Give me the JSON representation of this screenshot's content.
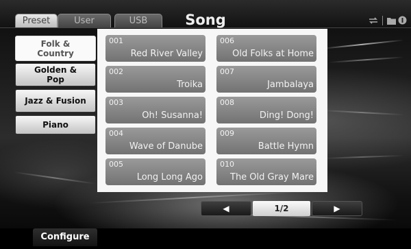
{
  "header": {
    "tabs": [
      {
        "label": "Preset",
        "active": true
      },
      {
        "label": "User",
        "active": false
      },
      {
        "label": "USB",
        "active": false
      }
    ],
    "title": "Song",
    "icons": [
      "repeat-icon",
      "folder-icon",
      "info-icon"
    ]
  },
  "categories": [
    {
      "label": "Folk & Country",
      "selected": true
    },
    {
      "label": "Golden & Pop",
      "selected": false
    },
    {
      "label": "Jazz & Fusion",
      "selected": false
    },
    {
      "label": "Piano",
      "selected": false
    }
  ],
  "songs": [
    {
      "number": "001",
      "name": "Red River Valley"
    },
    {
      "number": "002",
      "name": "Troika"
    },
    {
      "number": "003",
      "name": "Oh! Susanna!"
    },
    {
      "number": "004",
      "name": "Wave of Danube"
    },
    {
      "number": "005",
      "name": "Long Long Ago"
    },
    {
      "number": "006",
      "name": "Old Folks at Home"
    },
    {
      "number": "007",
      "name": "Jambalaya"
    },
    {
      "number": "008",
      "name": "Ding! Dong!"
    },
    {
      "number": "009",
      "name": "Battle Hymn"
    },
    {
      "number": "010",
      "name": "The Old Gray Mare"
    }
  ],
  "pager": {
    "prev_glyph": "◀",
    "page_label": "1/2",
    "next_glyph": "▶"
  },
  "bottom": {
    "configure_label": "Configure"
  }
}
